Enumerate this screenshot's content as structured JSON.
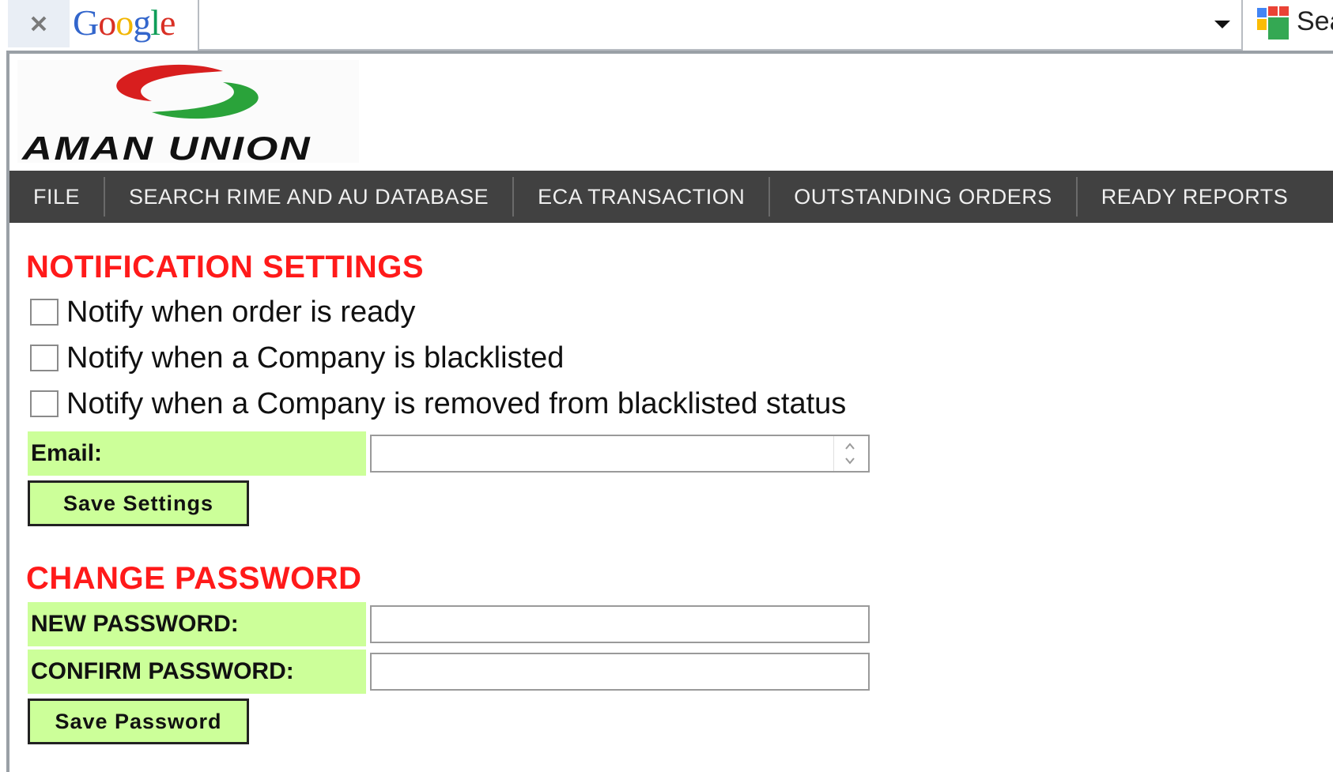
{
  "browser": {
    "toolbar_brand": [
      "G",
      "o",
      "o",
      "g",
      "l",
      "e"
    ],
    "brand_colors": [
      "#3366cc",
      "#d93025",
      "#f2b600",
      "#3366cc",
      "#0f9d58",
      "#d93025"
    ],
    "search_partial": "Sea"
  },
  "brand": {
    "name": "AMAN UNION",
    "colors": {
      "red": "#d81e1e",
      "green": "#2aa33a"
    }
  },
  "nav": {
    "items": [
      {
        "label": "FILE"
      },
      {
        "label": "SEARCH RIME AND AU DATABASE"
      },
      {
        "label": "ECA TRANSACTION"
      },
      {
        "label": "OUTSTANDING ORDERS"
      },
      {
        "label": "READY REPORTS"
      }
    ]
  },
  "notification": {
    "title": "NOTIFICATION SETTINGS",
    "options": [
      {
        "label": "Notify when order is ready",
        "checked": false
      },
      {
        "label": "Notify when a Company is blacklisted",
        "checked": false
      },
      {
        "label": "Notify when a Company is removed from blacklisted status",
        "checked": false
      }
    ],
    "email_label": "Email:",
    "email_value": "",
    "save_label": "Save Settings"
  },
  "password": {
    "title": "CHANGE PASSWORD",
    "new_label": "NEW PASSWORD:",
    "confirm_label": "CONFIRM PASSWORD:",
    "new_value": "",
    "confirm_value": "",
    "save_label": "Save Password"
  },
  "colors": {
    "heading": "#ff1a1a",
    "label_bg": "#ccff99",
    "nav_bg": "#414141"
  }
}
